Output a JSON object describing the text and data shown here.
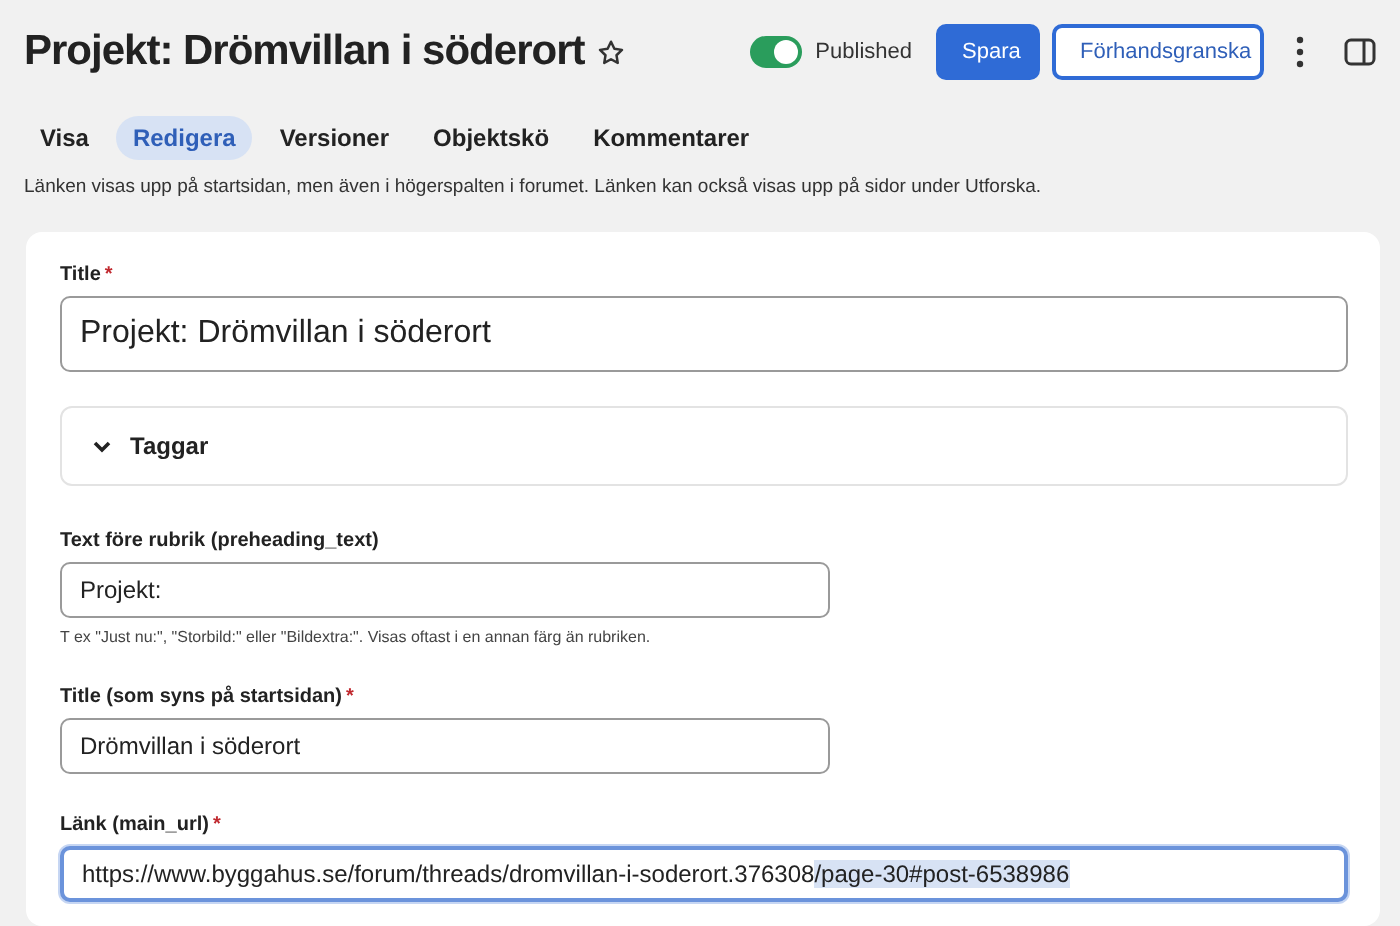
{
  "header": {
    "title": "Projekt: Drömvillan i söderort",
    "starred": false,
    "published": {
      "on": true,
      "label": "Published"
    },
    "buttons": [
      {
        "label": "Spara",
        "kind": "primary"
      },
      {
        "label": "Förhandsgranska",
        "kind": "secondary"
      }
    ]
  },
  "tabs": [
    {
      "label": "Visa",
      "selected": false
    },
    {
      "label": "Redigera",
      "selected": true
    },
    {
      "label": "Versioner",
      "selected": false
    },
    {
      "label": "Objektskö",
      "selected": false
    },
    {
      "label": "Kommentarer",
      "selected": false
    }
  ],
  "description": "Länken visas upp på startsidan, men även i högerspalten i forumet. Länken kan också visas upp på sidor under Utforska.",
  "form": {
    "title_field": {
      "label": "Title",
      "required_mark": "*",
      "value": "Projekt: Drömvillan i söderort"
    },
    "section": {
      "label": "Taggar",
      "expanded": false
    },
    "fields": [
      {
        "label": "Text före rubrik (preheading_text)",
        "value": "Projekt:",
        "hint": "T ex \"Just nu:\", \"Storbild:\" eller \"Bildextra:\". Visas oftast i en annan färg än rubriken.",
        "wide": false,
        "focused": false
      },
      {
        "label": "Title (som syns på startsidan)",
        "required_mark": "*",
        "value": "Drömvillan i söderort",
        "wide": false,
        "focused": false
      },
      {
        "label": "Länk (main_url)",
        "required_mark": "*",
        "value": "https://www.byggahus.se/forum/threads/dromvillan-i-soderort.376308",
        "selected_text": "/page-30#post-6538986",
        "wide": true,
        "focused": true
      }
    ]
  }
}
